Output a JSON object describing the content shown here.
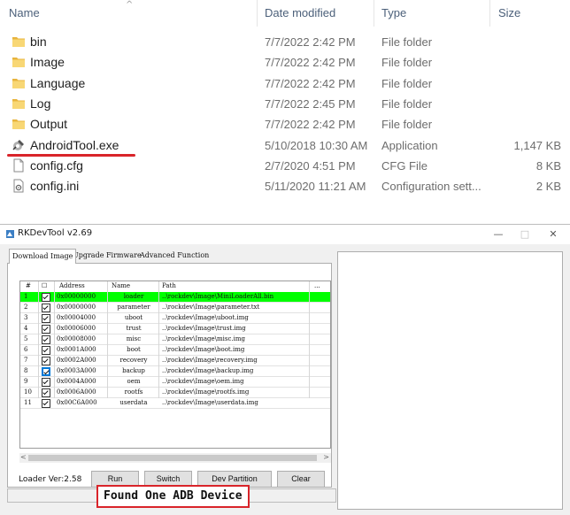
{
  "explorer": {
    "columns": {
      "name": "Name",
      "date": "Date modified",
      "type": "Type",
      "size": "Size"
    },
    "sort_glyph": "^",
    "rows": [
      {
        "icon": "folder-icon",
        "name": "bin",
        "date": "7/7/2022 2:42 PM",
        "type": "File folder",
        "size": ""
      },
      {
        "icon": "folder-icon",
        "name": "Image",
        "date": "7/7/2022 2:42 PM",
        "type": "File folder",
        "size": ""
      },
      {
        "icon": "folder-icon",
        "name": "Language",
        "date": "7/7/2022 2:42 PM",
        "type": "File folder",
        "size": ""
      },
      {
        "icon": "folder-icon",
        "name": "Log",
        "date": "7/7/2022 2:45 PM",
        "type": "File folder",
        "size": ""
      },
      {
        "icon": "folder-icon",
        "name": "Output",
        "date": "7/7/2022 2:42 PM",
        "type": "File folder",
        "size": ""
      },
      {
        "icon": "application-icon",
        "name": "AndroidTool.exe",
        "date": "5/10/2018 10:30 AM",
        "type": "Application",
        "size": "1,147 KB"
      },
      {
        "icon": "file-icon",
        "name": "config.cfg",
        "date": "2/7/2020 4:51 PM",
        "type": "CFG File",
        "size": "8 KB"
      },
      {
        "icon": "settings-file-icon",
        "name": "config.ini",
        "date": "5/11/2020 11:21 AM",
        "type": "Configuration sett...",
        "size": "2 KB"
      }
    ],
    "highlight_color": "#d9242a"
  },
  "rkdev": {
    "title": "RKDevTool v2.69",
    "window_controls": {
      "minimize": "—",
      "maximize": "□",
      "close": "✕"
    },
    "tabs": [
      "Download Image",
      "Upgrade Firmware",
      "Advanced Function"
    ],
    "grid": {
      "headers": {
        "num": "#",
        "check": "☐",
        "address": "Address",
        "name": "Name",
        "path": "Path",
        "more": "..."
      },
      "rows": [
        {
          "num": "1",
          "checked": true,
          "address": "0x00000000",
          "name": "loader",
          "path": "..\\rockdev\\Image\\MiniLoaderAll.bin",
          "highlight": true
        },
        {
          "num": "2",
          "checked": true,
          "address": "0x00000000",
          "name": "parameter",
          "path": "..\\rockdev\\Image\\parameter.txt"
        },
        {
          "num": "3",
          "checked": true,
          "address": "0x00004000",
          "name": "uboot",
          "path": "..\\rockdev\\Image\\uboot.img"
        },
        {
          "num": "4",
          "checked": true,
          "address": "0x00006000",
          "name": "trust",
          "path": "..\\rockdev\\Image\\trust.img"
        },
        {
          "num": "5",
          "checked": true,
          "address": "0x00008000",
          "name": "misc",
          "path": "..\\rockdev\\Image\\misc.img"
        },
        {
          "num": "6",
          "checked": true,
          "address": "0x0001A000",
          "name": "boot",
          "path": "..\\rockdev\\Image\\boot.img"
        },
        {
          "num": "7",
          "checked": true,
          "address": "0x0002A000",
          "name": "recovery",
          "path": "..\\rockdev\\Image\\recovery.img"
        },
        {
          "num": "8",
          "checked": true,
          "address": "0x0003A000",
          "name": "backup",
          "path": "..\\rockdev\\Image\\backup.img",
          "focused": true
        },
        {
          "num": "9",
          "checked": true,
          "address": "0x0004A000",
          "name": "oem",
          "path": "..\\rockdev\\Image\\oem.img"
        },
        {
          "num": "10",
          "checked": true,
          "address": "0x0006A000",
          "name": "rootfs",
          "path": "..\\rockdev\\Image\\rootfs.img"
        },
        {
          "num": "11",
          "checked": true,
          "address": "0x00C6A000",
          "name": "userdata",
          "path": "..\\rockdev\\Image\\userdata.img"
        }
      ],
      "highlight_color": "#00ff00"
    },
    "scroll": {
      "left": "<",
      "right": ">"
    },
    "loader_version": "Loader Ver:2.58",
    "buttons": {
      "run": "Run",
      "switch": "Switch",
      "dev_partition": "Dev Partition",
      "clear": "Clear"
    },
    "status": "Found One ADB Device"
  }
}
